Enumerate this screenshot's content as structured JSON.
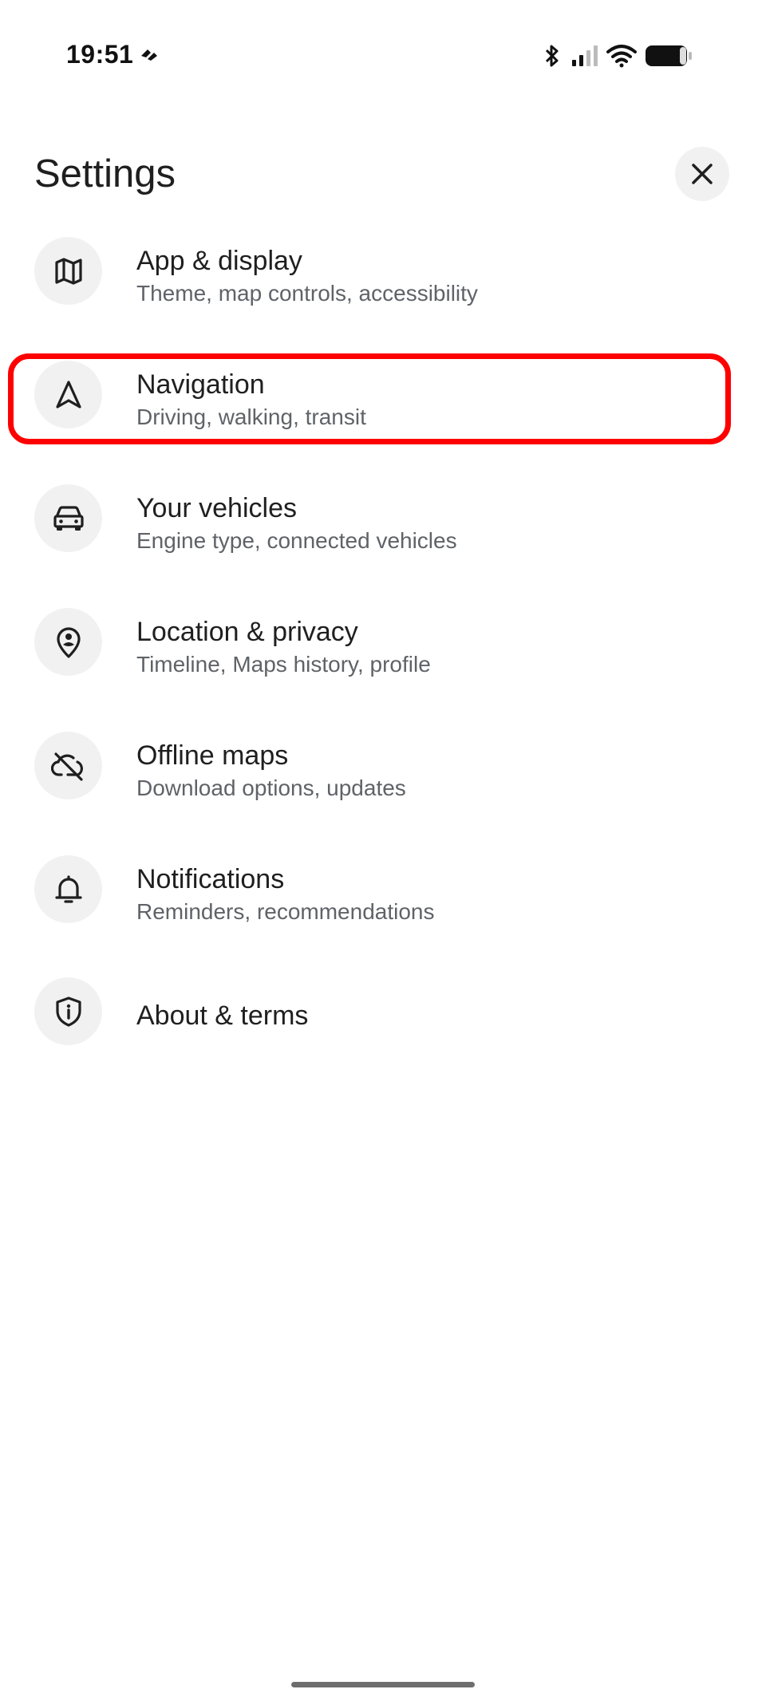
{
  "status_bar": {
    "time": "19:51",
    "icons": [
      "data-saver-icon",
      "bluetooth-icon",
      "cellular-signal-icon",
      "wifi-icon",
      "battery-icon"
    ]
  },
  "header": {
    "title": "Settings",
    "close_icon": "close-icon"
  },
  "settings": [
    {
      "icon": "map-icon",
      "title": "App & display",
      "subtitle": "Theme, map controls, accessibility"
    },
    {
      "icon": "navigation-arrow-icon",
      "title": "Navigation",
      "subtitle": "Driving, walking, transit",
      "highlighted": true
    },
    {
      "icon": "car-icon",
      "title": "Your vehicles",
      "subtitle": "Engine type, connected vehicles"
    },
    {
      "icon": "location-person-icon",
      "title": "Location & privacy",
      "subtitle": "Timeline, Maps history, profile"
    },
    {
      "icon": "cloud-off-icon",
      "title": "Offline maps",
      "subtitle": "Download options, updates"
    },
    {
      "icon": "bell-icon",
      "title": "Notifications",
      "subtitle": "Reminders, recommendations"
    },
    {
      "icon": "shield-info-icon",
      "title": "About & terms",
      "subtitle": ""
    }
  ],
  "colors": {
    "highlight": "#ff0000",
    "icon_background": "#f1f1f1",
    "title_text": "#1f1f1f",
    "subtitle_text": "#5f6368"
  }
}
